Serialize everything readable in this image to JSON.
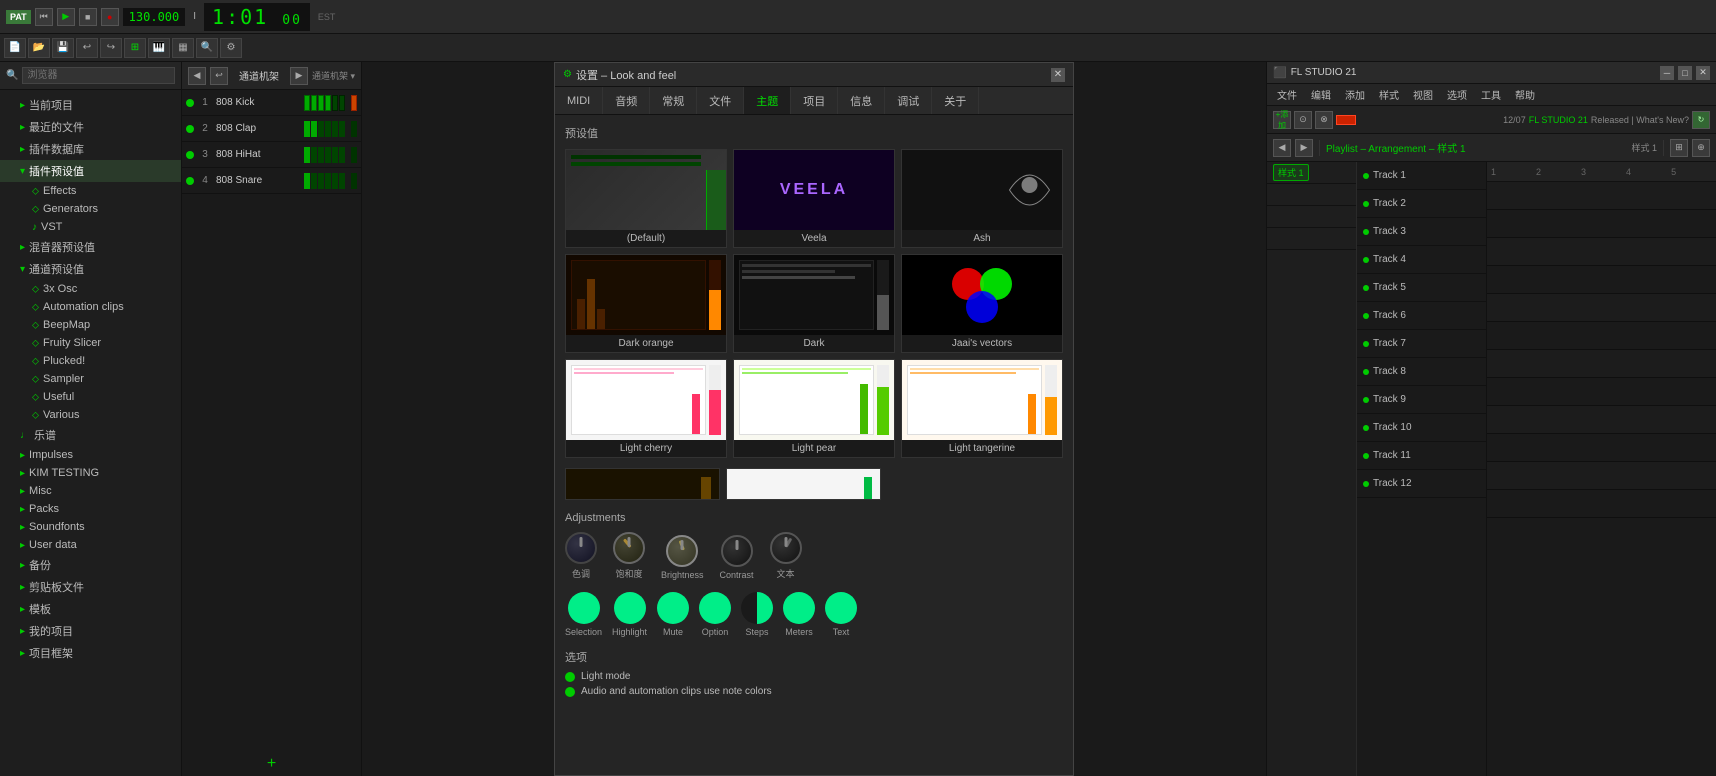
{
  "topbar": {
    "pat_label": "PAT",
    "bpm": "130.000",
    "time_sig": "I",
    "time_display": "1:01",
    "time_sub": "00",
    "time_label": "EST",
    "record_btn": "●",
    "play_btn": "▶",
    "stop_btn": "■",
    "rewind_btn": "◀◀"
  },
  "toolbar2": {
    "search_placeholder": "浏览器"
  },
  "sidebar": {
    "title": "浏览器",
    "items": [
      {
        "label": "当前项目",
        "icon": "▸",
        "indent": 1
      },
      {
        "label": "最近的文件",
        "icon": "▸",
        "indent": 1
      },
      {
        "label": "插件数据库",
        "icon": "▸",
        "indent": 1
      },
      {
        "label": "插件预设值",
        "icon": "▾",
        "indent": 1,
        "expanded": true
      },
      {
        "label": "Effects",
        "icon": "⬦",
        "indent": 2
      },
      {
        "label": "Generators",
        "icon": "⬦",
        "indent": 2
      },
      {
        "label": "VST",
        "icon": "♪",
        "indent": 2
      },
      {
        "label": "混音器预设值",
        "icon": "▸",
        "indent": 1
      },
      {
        "label": "通道预设值",
        "icon": "▾",
        "indent": 1,
        "expanded": true
      },
      {
        "label": "3x Osc",
        "icon": "⬦",
        "indent": 2
      },
      {
        "label": "Automation clips",
        "icon": "⬦",
        "indent": 2
      },
      {
        "label": "BeepMap",
        "icon": "⬦",
        "indent": 2
      },
      {
        "label": "Fruity Slicer",
        "icon": "⬦",
        "indent": 2
      },
      {
        "label": "Plucked!",
        "icon": "⬦",
        "indent": 2
      },
      {
        "label": "Sampler",
        "icon": "⬦",
        "indent": 2
      },
      {
        "label": "Useful",
        "icon": "⬦",
        "indent": 2
      },
      {
        "label": "Various",
        "icon": "⬦",
        "indent": 2
      },
      {
        "label": "乐谱",
        "icon": "♩",
        "indent": 1
      },
      {
        "label": "Impulses",
        "icon": "▸",
        "indent": 1
      },
      {
        "label": "KIM TESTING",
        "icon": "▸",
        "indent": 1
      },
      {
        "label": "Misc",
        "icon": "▸",
        "indent": 1
      },
      {
        "label": "Packs",
        "icon": "▸",
        "indent": 1
      },
      {
        "label": "Soundfonts",
        "icon": "▸",
        "indent": 1
      },
      {
        "label": "User data",
        "icon": "▸",
        "indent": 1
      },
      {
        "label": "备份",
        "icon": "▸",
        "indent": 1
      },
      {
        "label": "剪贴板文件",
        "icon": "▸",
        "indent": 1
      },
      {
        "label": "模板",
        "icon": "▸",
        "indent": 1
      },
      {
        "label": "我的项目",
        "icon": "▸",
        "indent": 1
      },
      {
        "label": "项目框架",
        "icon": "▸",
        "indent": 1
      }
    ]
  },
  "mixer": {
    "header_label": "通道机架",
    "channels": [
      {
        "num": "1",
        "name": "808 Kick"
      },
      {
        "num": "2",
        "name": "808 Clap"
      },
      {
        "num": "3",
        "name": "808 HiHat"
      },
      {
        "num": "4",
        "name": "808 Snare"
      }
    ],
    "add_label": "+"
  },
  "dialog": {
    "title": "设置 – Look and feel",
    "close_label": "✕",
    "nav_items": [
      "MIDI",
      "音频",
      "常规",
      "文件",
      "主题",
      "项目",
      "信息",
      "调试",
      "关于"
    ],
    "active_nav": "主题",
    "presets_label": "预设值",
    "presets": [
      {
        "name": "(Default)",
        "thumb_type": "default"
      },
      {
        "name": "Veela",
        "thumb_type": "veela"
      },
      {
        "name": "Ash",
        "thumb_type": "ash"
      },
      {
        "name": "Dark orange",
        "thumb_type": "dark_orange"
      },
      {
        "name": "Dark",
        "thumb_type": "dark"
      },
      {
        "name": "Jaai's vectors",
        "thumb_type": "jaai"
      },
      {
        "name": "Light cherry",
        "thumb_type": "light_cherry"
      },
      {
        "name": "Light pear",
        "thumb_type": "light_pear"
      },
      {
        "name": "Light tangerine",
        "thumb_type": "light_tangerine"
      }
    ],
    "adjustments_label": "Adjustments",
    "knobs": [
      {
        "label": "色调"
      },
      {
        "label": "饱和度"
      },
      {
        "label": "Brightness"
      },
      {
        "label": "Contrast"
      },
      {
        "label": "文本"
      }
    ],
    "color_buttons": [
      {
        "label": "Selection",
        "color": "green"
      },
      {
        "label": "Highlight",
        "color": "green"
      },
      {
        "label": "Mute",
        "color": "green"
      },
      {
        "label": "Option",
        "color": "green"
      },
      {
        "label": "Steps",
        "color": "dark_half"
      },
      {
        "label": "Meters",
        "color": "green"
      },
      {
        "label": "Text",
        "color": "green"
      }
    ],
    "options_label": "选项",
    "options": [
      {
        "label": "Light mode"
      },
      {
        "label": "Audio and automation clips use note colors"
      }
    ]
  },
  "fl_studio": {
    "title": "FL STUDIO 21",
    "date": "12/07",
    "released_label": "Released | What's New?",
    "playlist_title": "Playlist – Arrangement – 样式 1",
    "pattern_name": "样式 1",
    "tracks": [
      {
        "name": "Track 1"
      },
      {
        "name": "Track 2"
      },
      {
        "name": "Track 3"
      },
      {
        "name": "Track 4"
      },
      {
        "name": "Track 5"
      },
      {
        "name": "Track 6"
      },
      {
        "name": "Track 7"
      },
      {
        "name": "Track 8"
      },
      {
        "name": "Track 9"
      },
      {
        "name": "Track 10"
      },
      {
        "name": "Track 11"
      },
      {
        "name": "Track 12"
      }
    ],
    "menubar": [
      "文件",
      "编辑",
      "添加",
      "样式",
      "视图",
      "选项",
      "工具",
      "帮助"
    ]
  }
}
